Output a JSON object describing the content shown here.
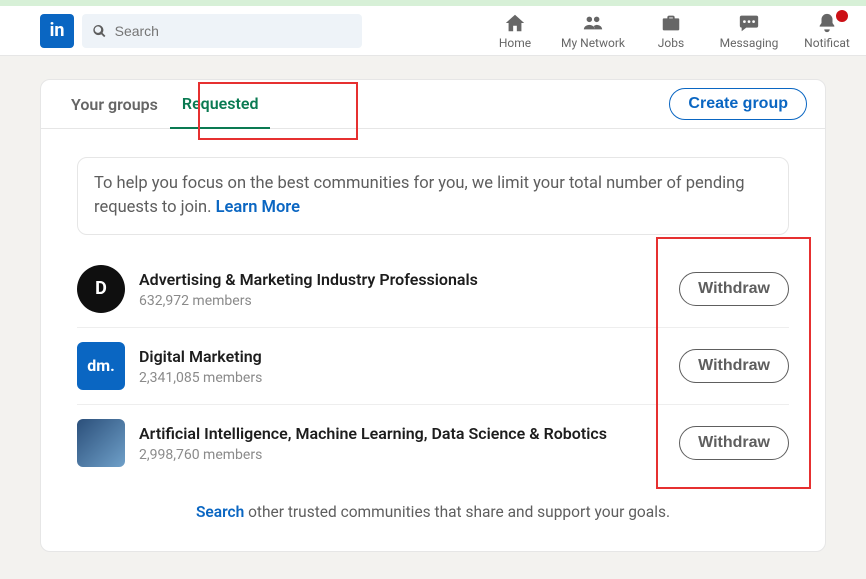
{
  "search": {
    "placeholder": "Search"
  },
  "nav": {
    "home": "Home",
    "network": "My Network",
    "jobs": "Jobs",
    "messaging": "Messaging",
    "notifications": "Notificat"
  },
  "tabs": {
    "your_groups": "Your groups",
    "requested": "Requested",
    "create_group": "Create group"
  },
  "info": {
    "text_prefix": "To help you focus on the best communities for you, we limit your total number of pending requests to join. ",
    "learn_more": "Learn More"
  },
  "groups": [
    {
      "name": "Advertising & Marketing Industry Professionals",
      "members": "632,972 members",
      "avatar_text": "D",
      "withdraw": "Withdraw"
    },
    {
      "name": "Digital Marketing",
      "members": "2,341,085 members",
      "avatar_text": "dm.",
      "withdraw": "Withdraw"
    },
    {
      "name": "Artificial Intelligence, Machine Learning, Data Science & Robotics",
      "members": "2,998,760 members",
      "avatar_text": "",
      "withdraw": "Withdraw"
    }
  ],
  "footer": {
    "search": "Search",
    "rest": " other trusted communities that share and support your goals."
  }
}
